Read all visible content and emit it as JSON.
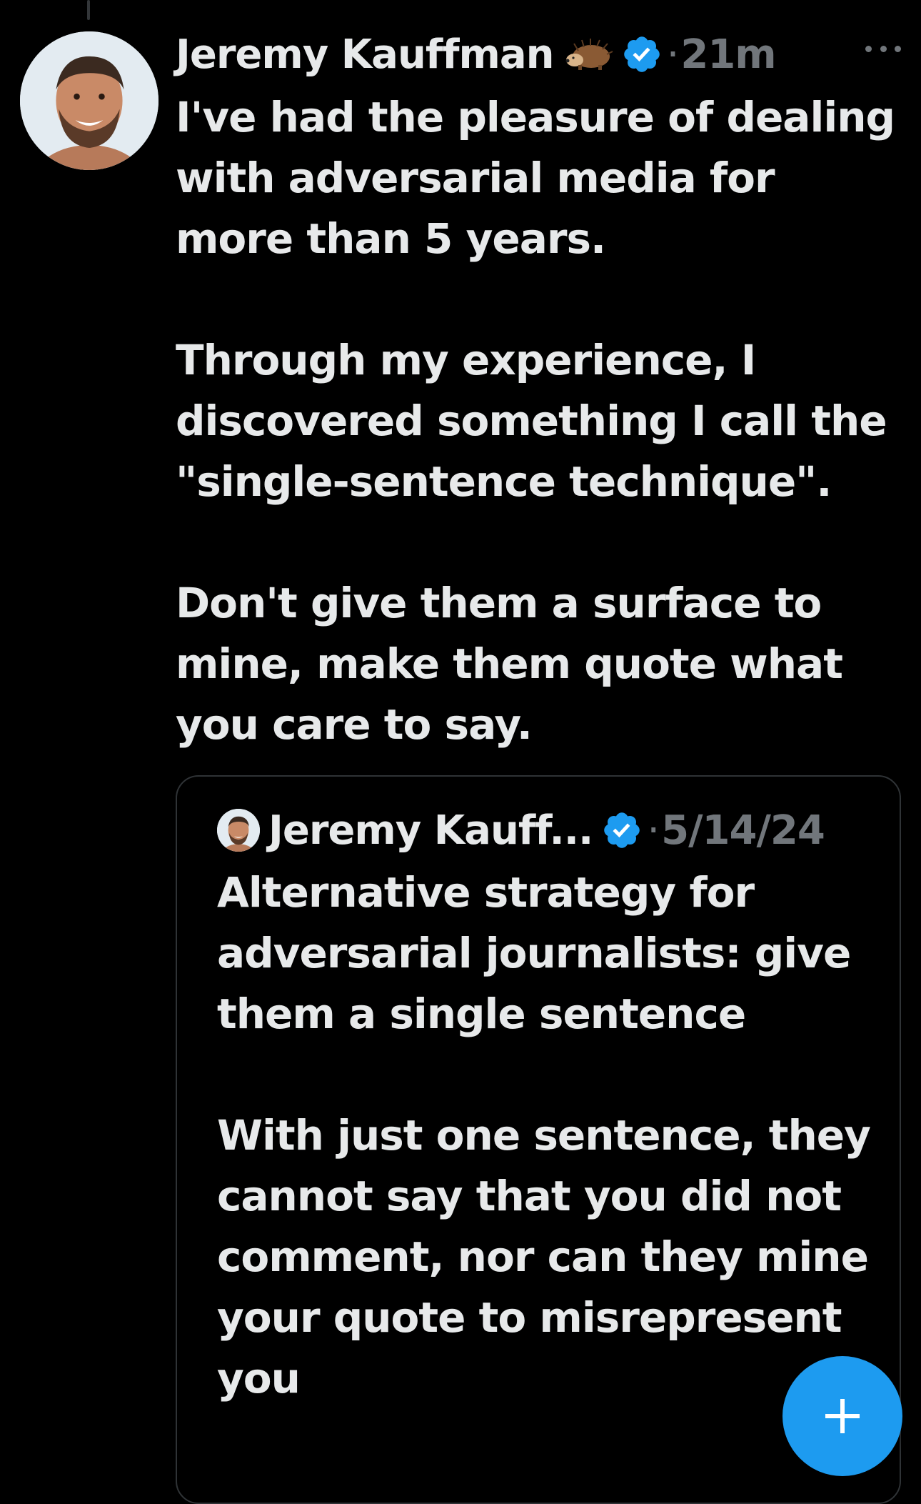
{
  "post": {
    "author": {
      "name": "Jeremy Kauffman",
      "badge_emoji_icon": "hedgehog-icon",
      "verified_icon": "verified-badge-icon"
    },
    "separator": "·",
    "time": "21m",
    "more_icon": "more-horizontal-icon",
    "paragraphs": [
      "I've had the pleasure of dealing with adversarial media for more than 5 years.",
      "Through my experience, I discovered something I call the \"single-sentence technique\".",
      "Don't give them a surface to mine, make them quote what you care to say."
    ]
  },
  "quote": {
    "author": {
      "name": "Jeremy Kauff...",
      "verified_icon": "verified-badge-icon"
    },
    "separator": "·",
    "date": "5/14/24",
    "paragraphs": [
      "Alternative strategy for adversarial journalists: give them a single sentence",
      "With just one sentence, they cannot say that you did not comment, nor can they mine your quote to misrepresent you"
    ]
  },
  "fab": {
    "icon": "plus-icon"
  },
  "colors": {
    "background": "#000000",
    "text": "#e7e9ea",
    "muted": "#71767b",
    "accent": "#1d9bf0",
    "border": "#2f3336"
  }
}
